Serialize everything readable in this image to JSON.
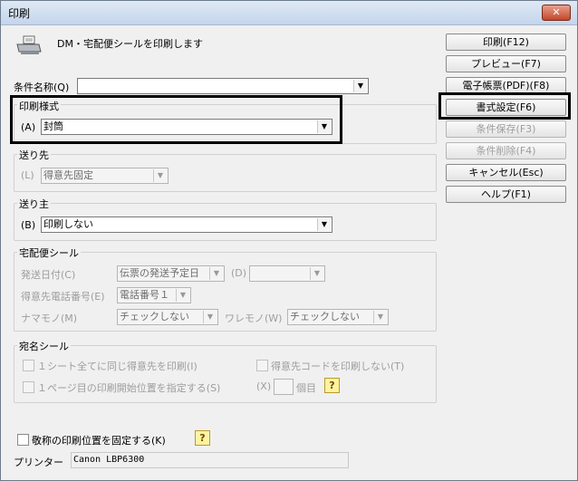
{
  "window": {
    "title": "印刷",
    "close_symbol": "✕"
  },
  "header": {
    "message": "DM・宅配便シールを印刷します",
    "icon": "printer-icon"
  },
  "buttons": {
    "print": "印刷(F12)",
    "preview": "プレビュー(F7)",
    "pdf": "電子帳票(PDF)(F8)",
    "format": "書式設定(F6)",
    "save": "条件保存(F3)",
    "delete": "条件削除(F4)",
    "cancel": "キャンセル(Esc)",
    "help": "ヘルプ(F1)"
  },
  "condition": {
    "label": "条件名称(Q)",
    "value": ""
  },
  "print_style": {
    "group": "印刷様式",
    "prefix": "(A)",
    "value": "封筒"
  },
  "destination": {
    "group": "送り先",
    "prefix": "(L)",
    "value": "得意先固定"
  },
  "sender": {
    "group": "送り主",
    "prefix": "(B)",
    "value": "印刷しない"
  },
  "delivery": {
    "group": "宅配便シール",
    "ship_date_label": "発送日付(C)",
    "ship_date_value": "伝票の発送予定日",
    "d_label": "(D)",
    "d_value": "",
    "phone_label": "得意先電話番号(E)",
    "phone_value": "電話番号１",
    "perishable_label": "ナマモノ(M)",
    "perishable_value": "チェックしない",
    "fragile_label": "ワレモノ(W)",
    "fragile_value": "チェックしない"
  },
  "address_seal": {
    "group": "宛名シール",
    "same_all_label": "１シート全てに同じ得意先を印刷(I)",
    "no_code_label": "得意先コードを印刷しない(T)",
    "start_pos_label": "１ページ目の印刷開始位置を指定する(S)",
    "x_label": "(X)",
    "count_value": "",
    "count_unit": "個目"
  },
  "honorific": {
    "label": "敬称の印刷位置を固定する(K)"
  },
  "printer": {
    "label": "プリンター",
    "value": "Canon LBP6300"
  },
  "help_glyph": "?",
  "arrow_glyph": "▼"
}
